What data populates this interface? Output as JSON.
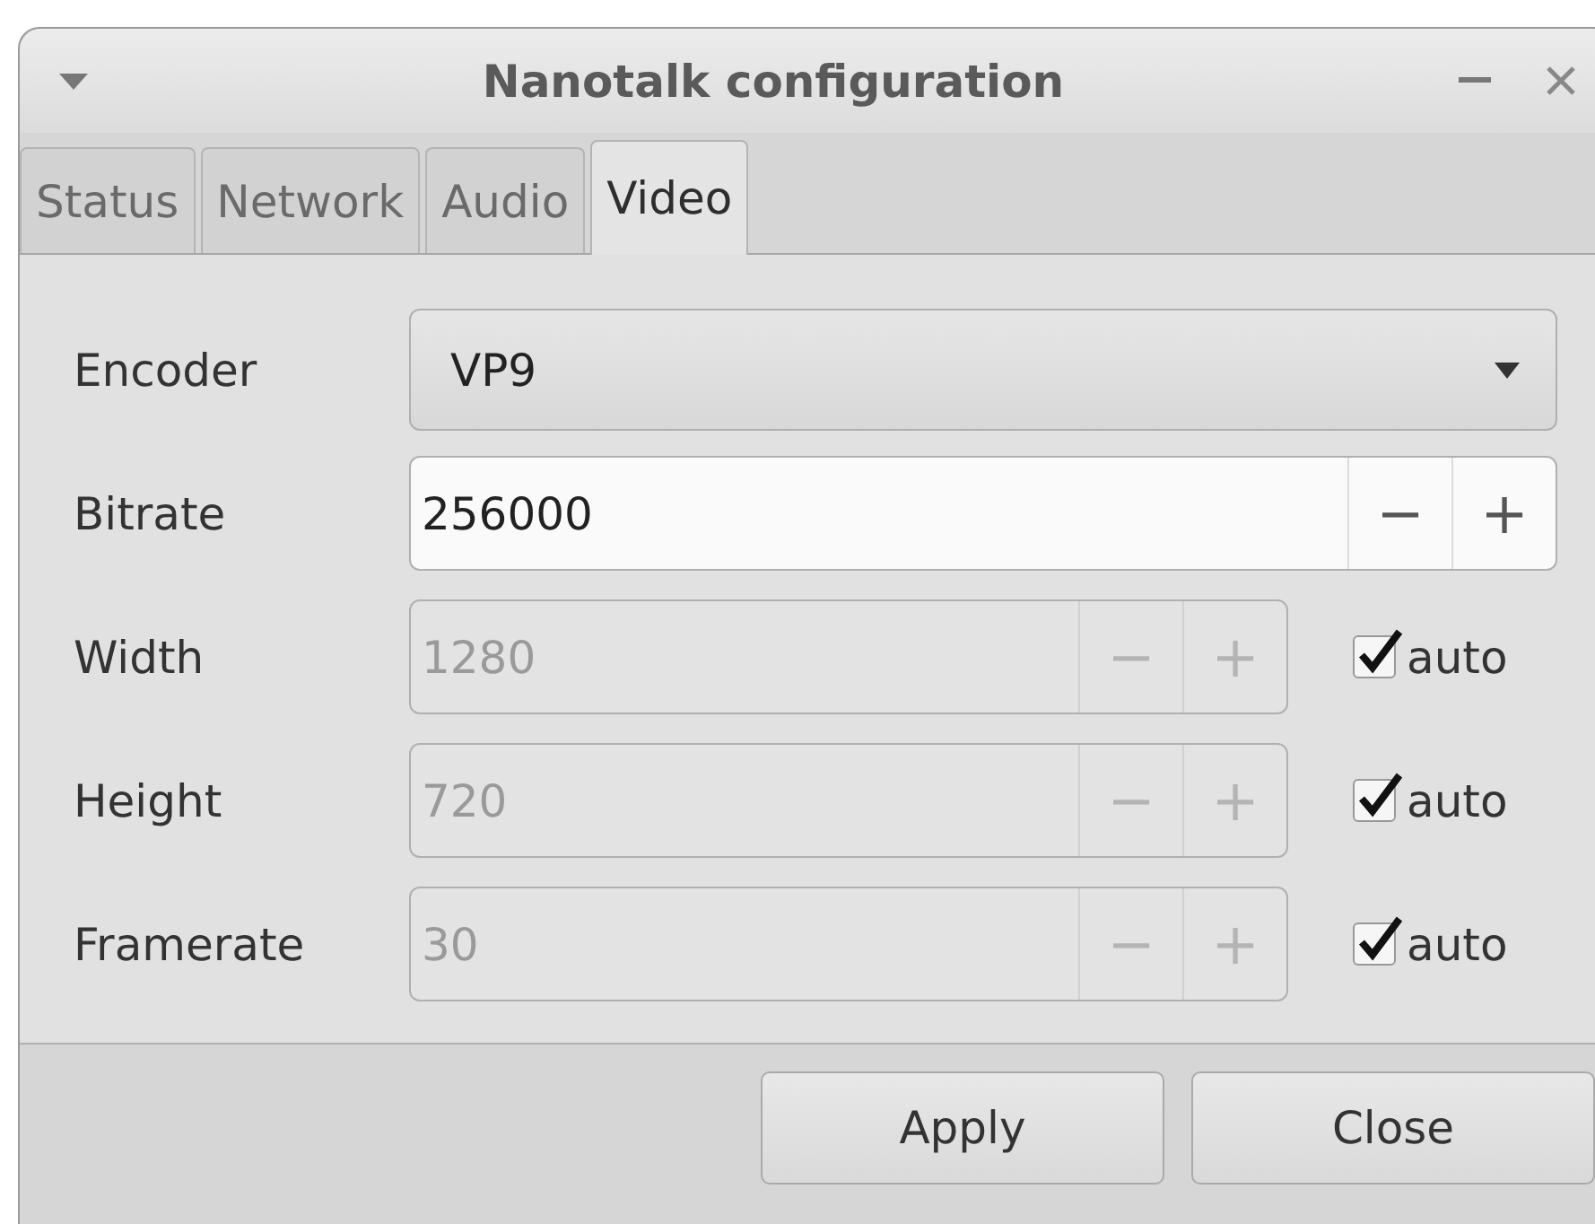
{
  "window": {
    "title": "Nanotalk configuration"
  },
  "tabs": [
    {
      "label": "Status",
      "selected": false
    },
    {
      "label": "Network",
      "selected": false
    },
    {
      "label": "Audio",
      "selected": false
    },
    {
      "label": "Video",
      "selected": true
    }
  ],
  "fields": [
    {
      "kind": "combo",
      "label": "Encoder",
      "value": "VP9",
      "disabled": false
    },
    {
      "kind": "spin",
      "label": "Bitrate",
      "value": "256000",
      "disabled": false,
      "decrement": "−",
      "increment": "+"
    },
    {
      "kind": "spin",
      "label": "Width",
      "value": "1280",
      "disabled": true,
      "decrement": "−",
      "increment": "+",
      "auto": {
        "label": "auto",
        "checked": true
      }
    },
    {
      "kind": "spin",
      "label": "Height",
      "value": "720",
      "disabled": true,
      "decrement": "−",
      "increment": "+",
      "auto": {
        "label": "auto",
        "checked": true
      }
    },
    {
      "kind": "spin",
      "label": "Framerate",
      "value": "30",
      "disabled": true,
      "decrement": "−",
      "increment": "+",
      "auto": {
        "label": "auto",
        "checked": true
      }
    }
  ],
  "buttons": [
    "Apply",
    "Close"
  ]
}
